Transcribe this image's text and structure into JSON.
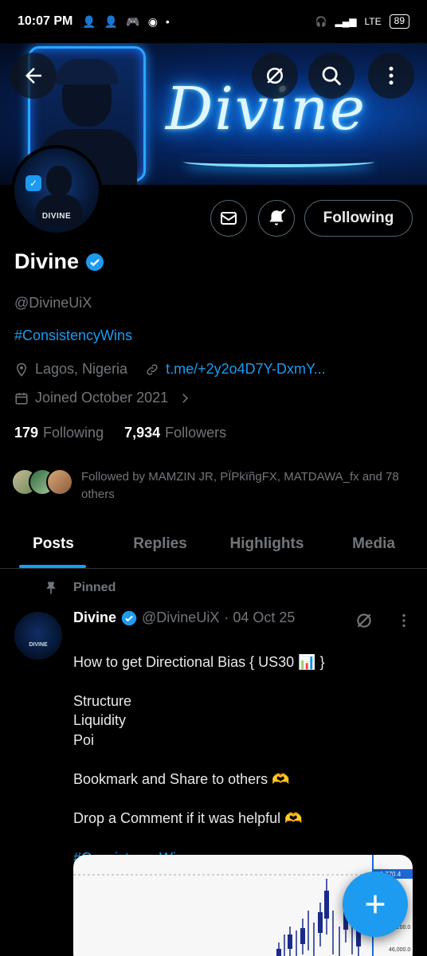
{
  "status_bar": {
    "time": "10:07 PM",
    "network": "LTE",
    "battery": "89"
  },
  "banner": {
    "neon_text": "Divine"
  },
  "avatar": {
    "label": "DIVINE"
  },
  "actions": {
    "follow_label": "Following"
  },
  "profile": {
    "name": "Divine",
    "handle": "@DivineUiX",
    "hashtag": "#ConsistencyWins",
    "location": "Lagos, Nigeria",
    "link": "t.me/+2y2o4D7Y-DxmY...",
    "joined": "Joined October 2021"
  },
  "stats": {
    "following_count": "179",
    "following_label": "Following",
    "followers_count": "7,934",
    "followers_label": "Followers"
  },
  "followed_by": "Followed by MAMZIN JR, PÏPkïñgFX, MATDAWA_fx and 78 others",
  "tabs": [
    "Posts",
    "Replies",
    "Highlights",
    "Media"
  ],
  "post": {
    "pinned_label": "Pinned",
    "avatar_label": "DIVINE",
    "name": "Divine",
    "handle": "@DivineUiX",
    "date": "· 04 Oct 25",
    "body": "How to get Directional Bias { US30 📊 }\n\nStructure\nLiquidity\nPoi\n\nBookmark and Share to others 🫶\n\nDrop a Comment if it was helpful 🫶\n",
    "hashtag": "#ConsistencyWins",
    "chart_price_labels": [
      "46,770.4",
      "46,200.0",
      "46,000.0"
    ]
  },
  "colors": {
    "accent": "#1d9bf0",
    "muted": "#71767b",
    "bg": "#000000"
  }
}
